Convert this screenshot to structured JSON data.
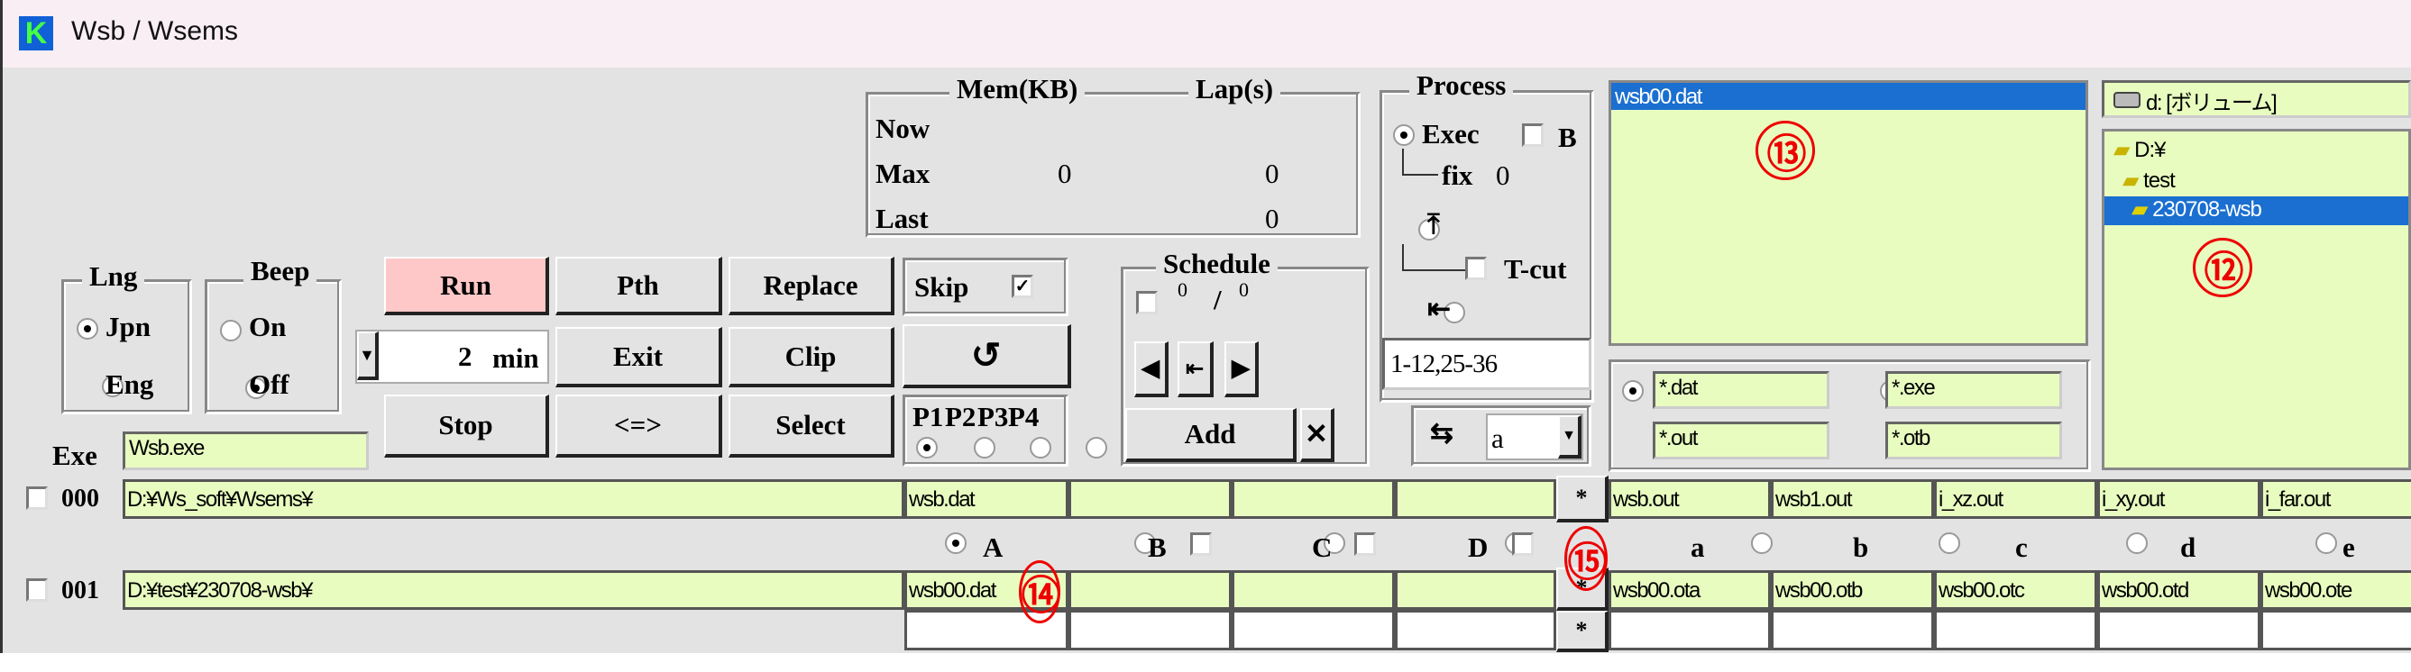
{
  "window": {
    "title": "Wsb / Wsems",
    "icon": "app-logo-icon"
  },
  "memory": {
    "col_mem": "Mem(KB)",
    "col_lap": "Lap(s)",
    "rows": [
      {
        "label": "Now",
        "mem": "",
        "lap": ""
      },
      {
        "label": "Max",
        "mem": "0",
        "lap": "0"
      },
      {
        "label": "Last",
        "mem": "",
        "lap": "0"
      }
    ]
  },
  "process": {
    "title": "Process",
    "exec": "Exec",
    "b": "B",
    "fix": "fix",
    "fix_value": "0",
    "tcut": "T-cut",
    "top_icon": "arrow-up-bar-icon",
    "left_icon": "arrow-left-bar-icon",
    "range": "1-12,25-36"
  },
  "lng": {
    "title": "Lng",
    "jpn": "Jpn",
    "eng": "Eng",
    "selected": "Jpn"
  },
  "beep": {
    "title": "Beep",
    "on": "On",
    "off": "Off",
    "selected": "Off"
  },
  "buttons": {
    "run": "Run",
    "pth": "Pth",
    "replace": "Replace",
    "exit": "Exit",
    "clip": "Clip",
    "stop": "Stop",
    "swap": "<=>",
    "select": "Select",
    "add": "Add",
    "close": "✕",
    "rotate": "↺"
  },
  "timer": {
    "value": "2",
    "unit": "min"
  },
  "skip": {
    "label": "Skip",
    "checked": true
  },
  "priority": {
    "labels": [
      "P1",
      "P2",
      "P3",
      "P4"
    ],
    "selected": "P1"
  },
  "schedule": {
    "title": "Schedule",
    "current": "0",
    "sep": "/",
    "total": "0"
  },
  "swap_select": {
    "value": "a"
  },
  "exe": {
    "label": "Exe",
    "value": "Wsb.exe"
  },
  "file_list": {
    "items": [
      "wsb00.dat"
    ],
    "selected": "wsb00.dat"
  },
  "filters": [
    "*.dat",
    "*.exe",
    "*.out",
    "*.otb"
  ],
  "filter_selected": "*.dat",
  "drive": {
    "label": "d: [ボリューム]"
  },
  "tree": {
    "items": [
      "D:¥",
      "test",
      "230708-wsb"
    ],
    "selected": "230708-wsb"
  },
  "rows": [
    {
      "id": "000",
      "path": "D:¥Ws_soft¥Wsems¥",
      "inputs": [
        "wsb.dat",
        "",
        "",
        ""
      ],
      "outputs": [
        "wsb.out",
        "wsb1.out",
        "i_xz.out",
        "i_xy.out",
        "i_far.out"
      ]
    },
    {
      "id": "001",
      "path": "D:¥test¥230708-wsb¥",
      "inputs": [
        "wsb00.dat",
        "",
        "",
        ""
      ],
      "outputs": [
        "wsb00.ota",
        "wsb00.otb",
        "wsb00.otc",
        "wsb00.otd",
        "wsb00.ote"
      ]
    }
  ],
  "star": "*",
  "input_radios": [
    "A",
    "B",
    "C",
    "D"
  ],
  "input_selected": "A",
  "output_radios": [
    "a",
    "b",
    "c",
    "d",
    "e"
  ],
  "annotations": [
    "⑬",
    "⑫",
    "⑭",
    "⑮"
  ],
  "annotation_numbers": [
    "13",
    "12",
    "14",
    "15"
  ],
  "colors": {
    "field": "#e8fcc0",
    "run": "#ffc8c8",
    "selection": "#1a6fd0",
    "annotation": "#e00000"
  }
}
